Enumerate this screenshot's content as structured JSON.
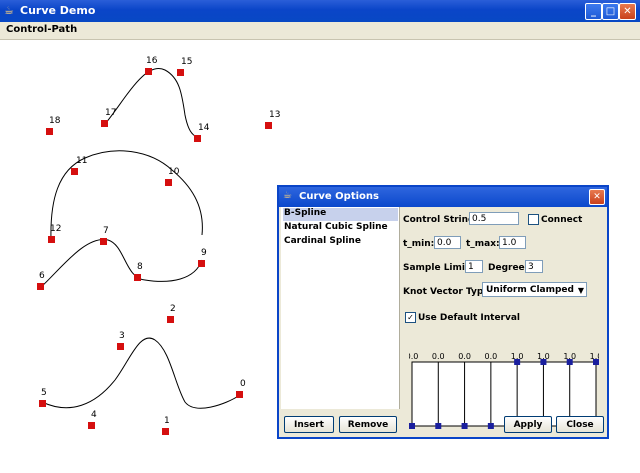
{
  "main_window": {
    "title": "Curve Demo",
    "menu": [
      "Control-Path"
    ]
  },
  "canvas_labels": [
    "0",
    "1",
    "2",
    "3",
    "4",
    "5",
    "6",
    "7",
    "8",
    "9",
    "10",
    "11",
    "12",
    "13",
    "14",
    "15",
    "16",
    "17",
    "18"
  ],
  "dialog": {
    "title": "Curve Options",
    "list_items": [
      "B-Spline",
      "Natural Cubic Spline",
      "Cardinal Spline"
    ],
    "selected_item": "B-Spline",
    "control_string_label": "Control String:",
    "control_string_value": "0.5",
    "connect_label": "Connect",
    "t_min_label": "t_min:",
    "t_min_value": "0.0",
    "t_max_label": "t_max:",
    "t_max_value": "1.0",
    "sample_limit_label": "Sample Limit:",
    "sample_limit_value": "1",
    "degree_label": "Degree:",
    "degree_value": "3",
    "knot_vector_label": "Knot Vector Type:",
    "knot_vector_value": "Uniform Clamped",
    "use_default_interval_label": "Use Default Interval",
    "knot_values": [
      "0.0",
      "0.0",
      "0.0",
      "0.0",
      "1.0",
      "1.0",
      "1.0",
      "1.0"
    ],
    "buttons": {
      "insert": "Insert",
      "remove": "Remove",
      "apply": "Apply",
      "close": "Close"
    }
  }
}
